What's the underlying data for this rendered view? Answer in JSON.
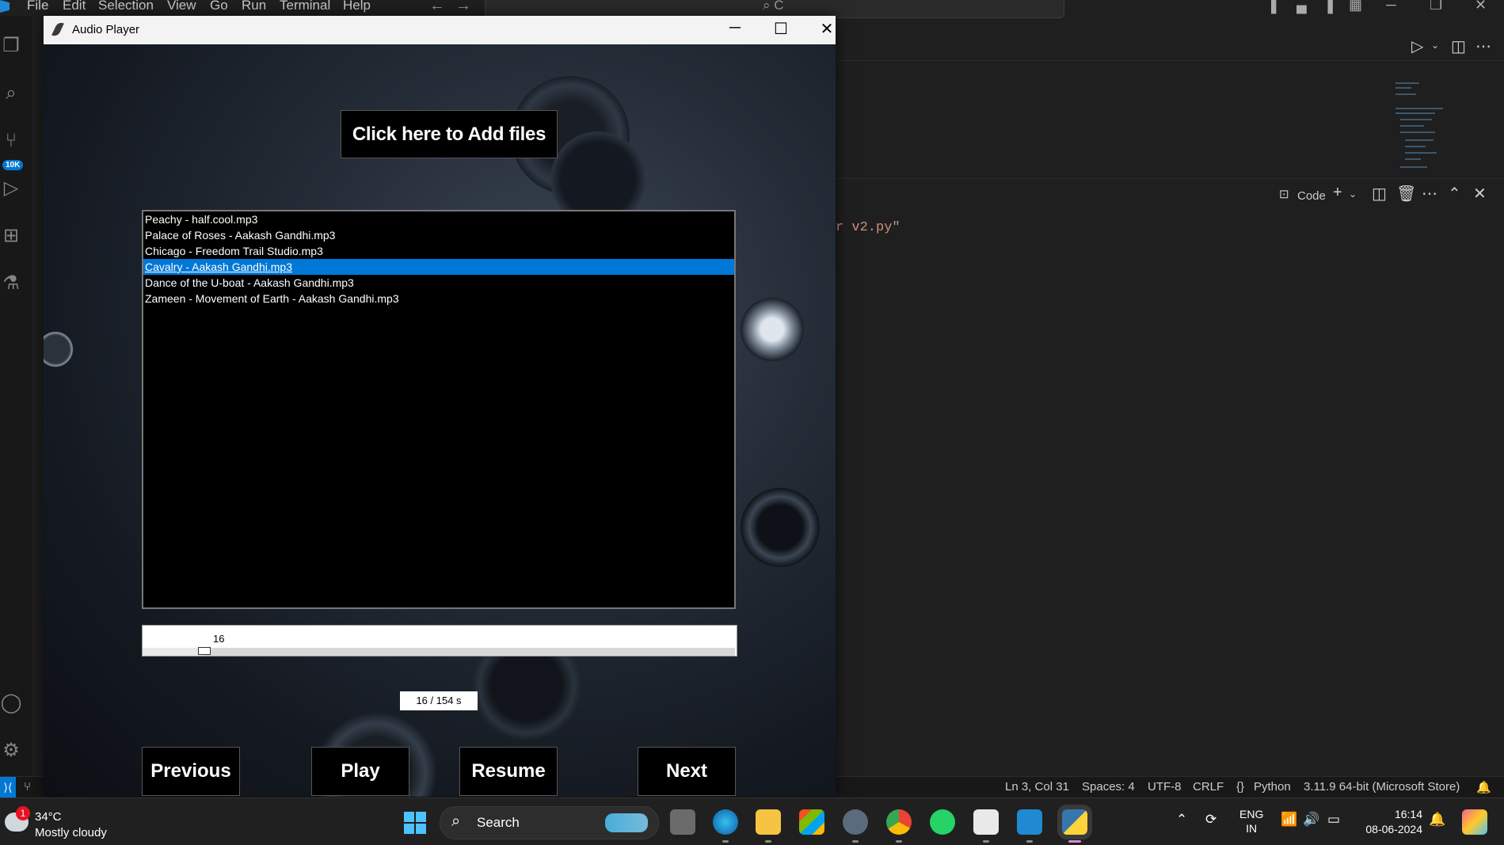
{
  "vscode": {
    "menu": [
      "File",
      "Edit",
      "Selection",
      "View",
      "Go",
      "Run",
      "Terminal",
      "Help"
    ],
    "search_placeholder": "C",
    "source_control_badge": "10K",
    "panel_label": "Code",
    "code_fragment": "r v2.py\"",
    "status": {
      "position": "Ln 3, Col 31",
      "spaces": "Spaces: 4",
      "encoding": "UTF-8",
      "eol": "CRLF",
      "language": "Python",
      "interpreter": "3.11.9 64-bit (Microsoft Store)"
    }
  },
  "player": {
    "window_title": "Audio Player",
    "add_files_label": "Click here to Add files",
    "playlist": [
      "Peachy - half.cool.mp3",
      "Palace of Roses - Aakash Gandhi.mp3",
      "Chicago - Freedom Trail Studio.mp3",
      "Cavalry - Aakash Gandhi.mp3",
      "Dance of the U-boat - Aakash Gandhi.mp3",
      "Zameen - Movement of Earth - Aakash Gandhi.mp3"
    ],
    "selected_index": 3,
    "slider": {
      "value": 16,
      "max": 154,
      "label": "16"
    },
    "time_label": "16 / 154 s",
    "buttons": {
      "previous": "Previous",
      "play": "Play",
      "resume": "Resume",
      "next": "Next"
    }
  },
  "taskbar": {
    "weather": {
      "temp": "34°C",
      "desc": "Mostly cloudy",
      "badge": "1"
    },
    "search_label": "Search",
    "lang": {
      "line1": "ENG",
      "line2": "IN"
    },
    "clock": {
      "time": "16:14",
      "date": "08-06-2024"
    }
  },
  "colors": {
    "selection": "#0078d7",
    "vscode_accent": "#0078d4",
    "start": "#4cc2ff"
  },
  "icons": [
    "search-icon",
    "files-icon",
    "source-control-icon",
    "run-debug-icon",
    "extensions-icon",
    "testing-icon",
    "account-icon",
    "gear-icon"
  ]
}
